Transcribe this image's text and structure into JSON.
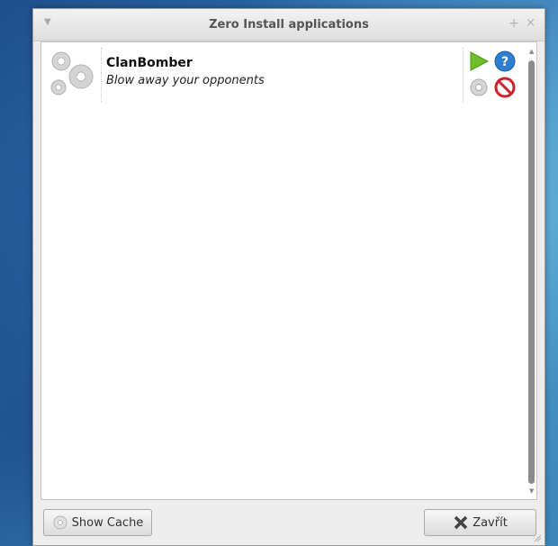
{
  "window": {
    "title": "Zero Install applications"
  },
  "apps": [
    {
      "name": "ClanBomber",
      "description": "Blow away your opponents",
      "actions": [
        "run",
        "help",
        "preferences",
        "remove"
      ]
    }
  ],
  "buttons": {
    "show_cache": "Show Cache",
    "close": "Zavřít"
  },
  "icons": {
    "run": "play-icon",
    "help": "help-icon",
    "preferences": "gear-icon",
    "remove": "remove-icon"
  },
  "colors": {
    "run": "#6fbf2a",
    "help": "#2e7fd0",
    "remove": "#d0202a"
  }
}
